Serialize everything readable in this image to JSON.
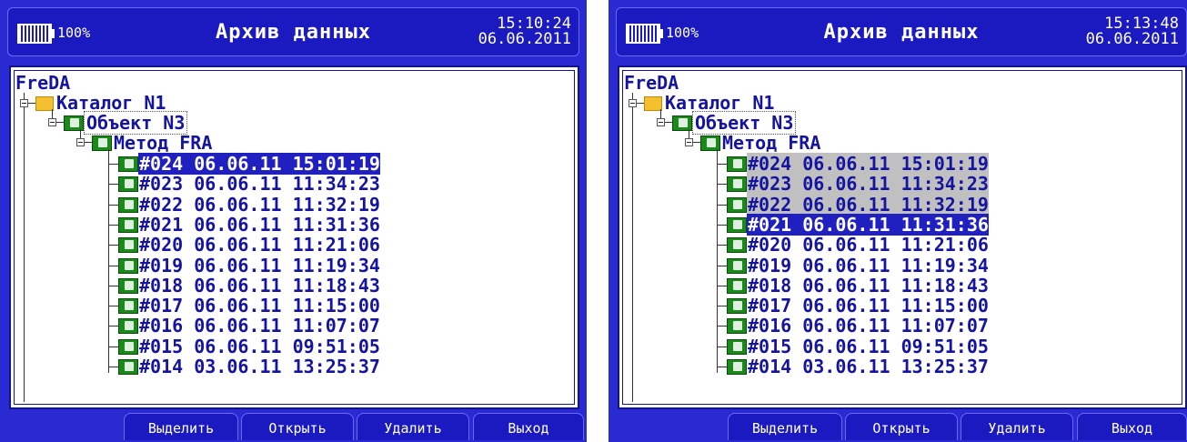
{
  "screens": [
    {
      "battery": "100%",
      "title": "Архив данных",
      "time": "15:10:24",
      "date": "06.06.2011",
      "tree": {
        "root": "FreDA",
        "catalog": "Каталог N1",
        "object": "Объект N3",
        "method": "Метод FRA",
        "records": [
          "#024 06.06.11 15:01:19",
          "#023 06.06.11 11:34:23",
          "#022 06.06.11 11:32:19",
          "#021 06.06.11 11:31:36",
          "#020 06.06.11 11:21:06",
          "#019 06.06.11 11:19:34",
          "#018 06.06.11 11:18:43",
          "#017 06.06.11 11:15:00",
          "#016 06.06.11 11:07:07",
          "#015 06.06.11 09:51:05",
          "#014 03.06.11 13:25:37"
        ],
        "selected_index": 0,
        "marked_indices": []
      },
      "buttons": [
        "Выделить",
        "Открыть",
        "Удалить",
        "Выход"
      ]
    },
    {
      "battery": "100%",
      "title": "Архив данных",
      "time": "15:13:48",
      "date": "06.06.2011",
      "tree": {
        "root": "FreDA",
        "catalog": "Каталог N1",
        "object": "Объект N3",
        "method": "Метод FRA",
        "records": [
          "#024 06.06.11 15:01:19",
          "#023 06.06.11 11:34:23",
          "#022 06.06.11 11:32:19",
          "#021 06.06.11 11:31:36",
          "#020 06.06.11 11:21:06",
          "#019 06.06.11 11:19:34",
          "#018 06.06.11 11:18:43",
          "#017 06.06.11 11:15:00",
          "#016 06.06.11 11:07:07",
          "#015 06.06.11 09:51:05",
          "#014 03.06.11 13:25:37"
        ],
        "selected_index": 3,
        "marked_indices": [
          0,
          1,
          2
        ]
      },
      "buttons": [
        "Выделить",
        "Открыть",
        "Удалить",
        "Выход"
      ]
    }
  ],
  "colors": {
    "frame_blue": "#2a2ad2",
    "header_blue": "#1a1ac0",
    "text_blue": "#1414a0",
    "selection": "#2020c0",
    "marked": "#c0c0c0"
  },
  "icons": {
    "folder": "folder-icon",
    "object": "object-icon",
    "record": "record-icon",
    "battery": "battery-icon",
    "expander": "tree-expander-icon"
  }
}
